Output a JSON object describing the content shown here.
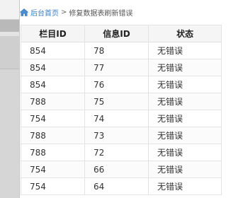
{
  "breadcrumb": {
    "home_label": "后台首页",
    "separator": ">",
    "current": "修复数据表刷新错误"
  },
  "table": {
    "headers": [
      "栏目ID",
      "信息ID",
      "状态"
    ],
    "rows": [
      [
        "854",
        "78",
        "无错误"
      ],
      [
        "854",
        "77",
        "无错误"
      ],
      [
        "854",
        "76",
        "无错误"
      ],
      [
        "788",
        "75",
        "无错误"
      ],
      [
        "754",
        "74",
        "无错误"
      ],
      [
        "788",
        "73",
        "无错误"
      ],
      [
        "788",
        "72",
        "无错误"
      ],
      [
        "754",
        "66",
        "无错误"
      ],
      [
        "754",
        "64",
        "无错误"
      ]
    ]
  },
  "colors": {
    "link": "#3a7ec2",
    "header_bg": "#f5f5f5",
    "border": "#e3e3e3"
  },
  "icons": {
    "home": "home-icon"
  }
}
